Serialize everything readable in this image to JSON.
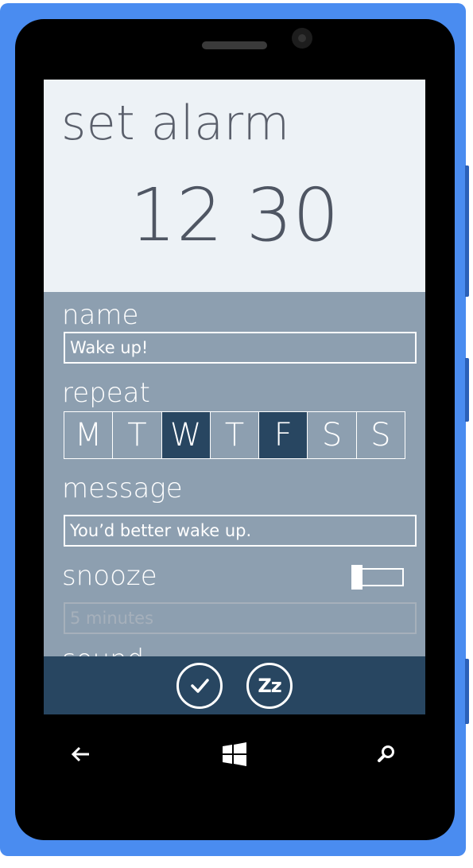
{
  "header": {
    "title": "set alarm",
    "time": "12 30"
  },
  "form": {
    "name": {
      "label": "name",
      "value": "Wake up!"
    },
    "repeat": {
      "label": "repeat",
      "days": [
        {
          "label": "M",
          "selected": false
        },
        {
          "label": "T",
          "selected": false
        },
        {
          "label": "W",
          "selected": true
        },
        {
          "label": "T",
          "selected": false
        },
        {
          "label": "F",
          "selected": true
        },
        {
          "label": "S",
          "selected": false
        },
        {
          "label": "S",
          "selected": false
        }
      ]
    },
    "message": {
      "label": "message",
      "value": "You’d better wake up."
    },
    "snooze": {
      "label": "snooze",
      "enabled": false,
      "duration_placeholder": "5 minutes"
    },
    "next_section_peek": "sound"
  },
  "app_bar": {
    "confirm_icon": "checkmark-icon",
    "snooze_icon": "zz-icon",
    "snooze_text": "Zz"
  },
  "hardware_nav": {
    "back_icon": "back-arrow-icon",
    "start_icon": "windows-logo-icon",
    "search_icon": "search-icon"
  },
  "colors": {
    "phone_frame": "#4a8cf0",
    "header_bg": "#edf2f6",
    "form_bg": "#8d9fb0",
    "accent": "#284661"
  }
}
